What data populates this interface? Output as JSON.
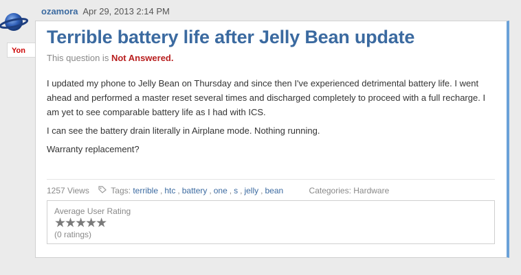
{
  "post": {
    "author": "ozamora",
    "date": "Apr 29, 2013 2:14 PM",
    "rank_badge": "Yon",
    "title": "Terrible battery life after Jelly Bean update",
    "status_prefix": "This question is",
    "status": "Not Answered.",
    "body": [
      "I updated my phone to Jelly Bean on Thursday  and since then I've experienced detrimental battery life. I went ahead and performed a master reset several times and discharged completely to proceed with a full recharge. I am yet to see comparable battery life as I had with ICS.",
      "I can see the battery drain literally in Airplane mode. Nothing running.",
      "Warranty replacement?"
    ]
  },
  "footer": {
    "views": "1257 Views",
    "tags_label": "Tags:",
    "tags": [
      "terrible",
      "htc",
      "battery",
      "one",
      "s",
      "jelly",
      "bean"
    ],
    "categories": "Categories: Hardware"
  },
  "rating": {
    "label": "Average User Rating",
    "stars": "★★★★★",
    "count": "(0 ratings)"
  },
  "colors": {
    "accent": "#3b6aa0",
    "status": "#b81e1e",
    "card_edge": "#6aa1d8"
  },
  "icons": {
    "avatar": "planet-icon",
    "tag": "tag-icon"
  }
}
